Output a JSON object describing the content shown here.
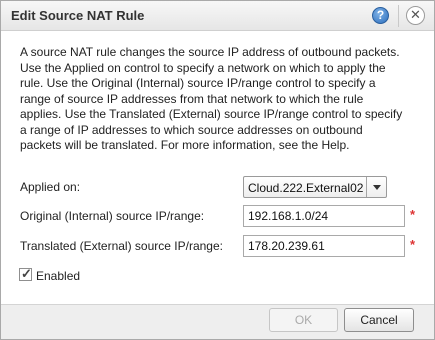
{
  "dialog": {
    "title": "Edit Source NAT Rule",
    "help_glyph": "?",
    "close_glyph": "✕"
  },
  "description": {
    "line1": "A source NAT rule changes the source IP address of outbound packets.",
    "line2": "Use the Applied on control to specify a network on which to apply the",
    "line3": "rule. Use the Original (Internal) source IP/range control to specify a",
    "line4": "range of source IP addresses from that network to which the rule",
    "line5": "applies. Use the Translated (External) source IP/range control to specify",
    "line6": "a range of IP addresses to which source addresses on outbound",
    "line7": "packets will be translated. For more information, see the Help."
  },
  "form": {
    "applied_on": {
      "label": "Applied on:",
      "value": "Cloud.222.External02"
    },
    "original_range": {
      "label": "Original (Internal) source IP/range:",
      "value": "192.168.1.0/24",
      "required_marker": "*"
    },
    "translated_range": {
      "label": "Translated (External) source IP/range:",
      "value": "178.20.239.61",
      "required_marker": "*"
    },
    "enabled": {
      "label": "Enabled",
      "checked": true,
      "check_glyph": "✓"
    }
  },
  "footer": {
    "ok_label": "OK",
    "cancel_label": "Cancel"
  },
  "colors": {
    "required": "#dd3333",
    "help_icon": "#2e6fbe"
  }
}
